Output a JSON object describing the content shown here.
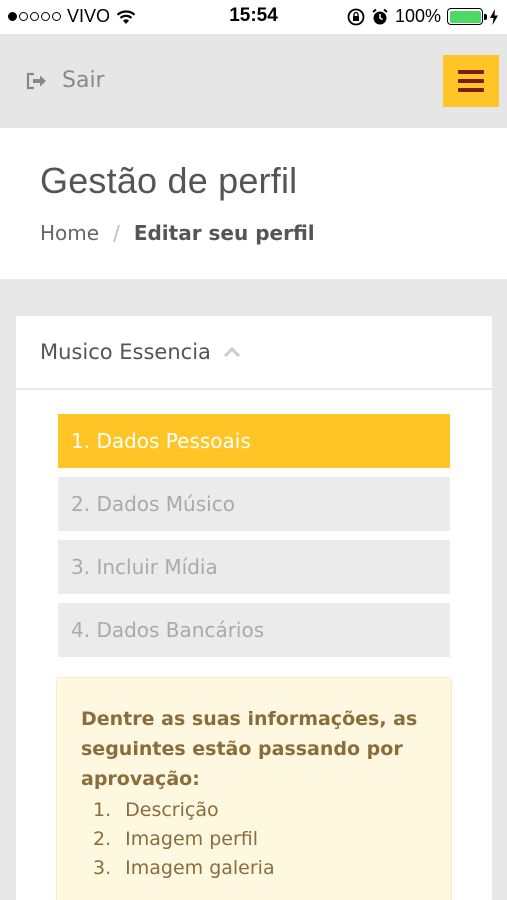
{
  "status_bar": {
    "carrier": "VIVO",
    "time": "15:54",
    "battery": "100%",
    "signal_bars_filled": 1,
    "signal_bars_total": 5
  },
  "header": {
    "logout_label": "Sair",
    "menu_color": "#ffc425"
  },
  "page": {
    "title": "Gestão de perfil",
    "breadcrumb": {
      "home": "Home",
      "separator": "/",
      "current": "Editar seu perfil"
    }
  },
  "card": {
    "title": "Musico Essencia",
    "steps": [
      {
        "label": "1. Dados Pessoais",
        "active": true
      },
      {
        "label": "2. Dados Músico",
        "active": false
      },
      {
        "label": "3. Incluir Mídia",
        "active": false
      },
      {
        "label": "4. Dados Bancários",
        "active": false
      }
    ],
    "alert": {
      "title": "Dentre as suas informações, as seguintes estão passando por aprovação:",
      "items": [
        {
          "num": "1.",
          "text": "Descrição"
        },
        {
          "num": "2.",
          "text": "Imagem perfil"
        },
        {
          "num": "3.",
          "text": "Imagem galeria"
        }
      ]
    }
  },
  "colors": {
    "accent": "#ffc425",
    "menu_icon": "#7b1b1b",
    "alert_text": "#8a6d3b",
    "alert_bg": "#fff8e1"
  }
}
